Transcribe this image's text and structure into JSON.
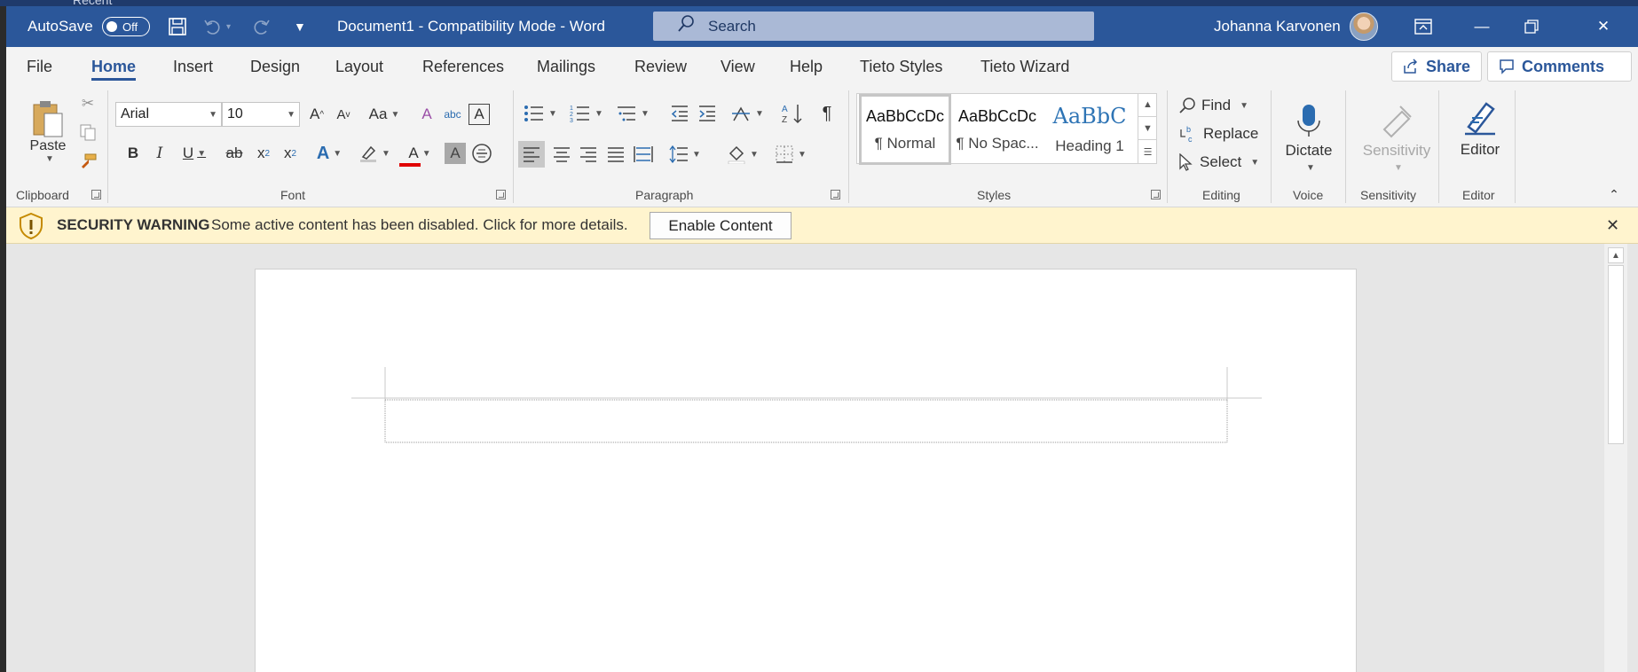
{
  "background": {
    "recent_label": "Recent"
  },
  "titlebar": {
    "autosave_label": "AutoSave",
    "autosave_state": "Off",
    "doc_title": "Document1  -  Compatibility Mode  -  Word",
    "search_placeholder": "Search",
    "user_name": "Johanna Karvonen"
  },
  "menu": {
    "tabs": [
      "File",
      "Home",
      "Insert",
      "Design",
      "Layout",
      "References",
      "Mailings",
      "Review",
      "View",
      "Help",
      "Tieto Styles",
      "Tieto Wizard"
    ],
    "active_tab": "Home",
    "share_label": "Share",
    "comments_label": "Comments"
  },
  "ribbon": {
    "clipboard": {
      "label": "Clipboard",
      "paste_label": "Paste"
    },
    "font": {
      "label": "Font",
      "font_name": "Arial",
      "font_size": "10"
    },
    "paragraph": {
      "label": "Paragraph"
    },
    "styles": {
      "label": "Styles",
      "tiles": [
        {
          "sample": "AaBbCcDc",
          "name": "¶ Normal"
        },
        {
          "sample": "AaBbCcDc",
          "name": "¶ No Spac..."
        },
        {
          "sample": "AaBbC",
          "name": "Heading 1"
        }
      ]
    },
    "editing": {
      "label": "Editing",
      "find_label": "Find",
      "replace_label": "Replace",
      "select_label": "Select"
    },
    "voice": {
      "label": "Voice",
      "dictate_label": "Dictate"
    },
    "sensitivity": {
      "label": "Sensitivity",
      "button_label": "Sensitivity"
    },
    "editor": {
      "label": "Editor",
      "button_label": "Editor"
    }
  },
  "security_bar": {
    "title": "SECURITY WARNING",
    "message": "Some active content has been disabled. Click for more details.",
    "button_label": "Enable Content"
  },
  "colors": {
    "title_bar": "#2b579a",
    "security_bar": "#fff4ce",
    "font_color_accent": "#e00000",
    "heading_style": "#2e74b5"
  }
}
